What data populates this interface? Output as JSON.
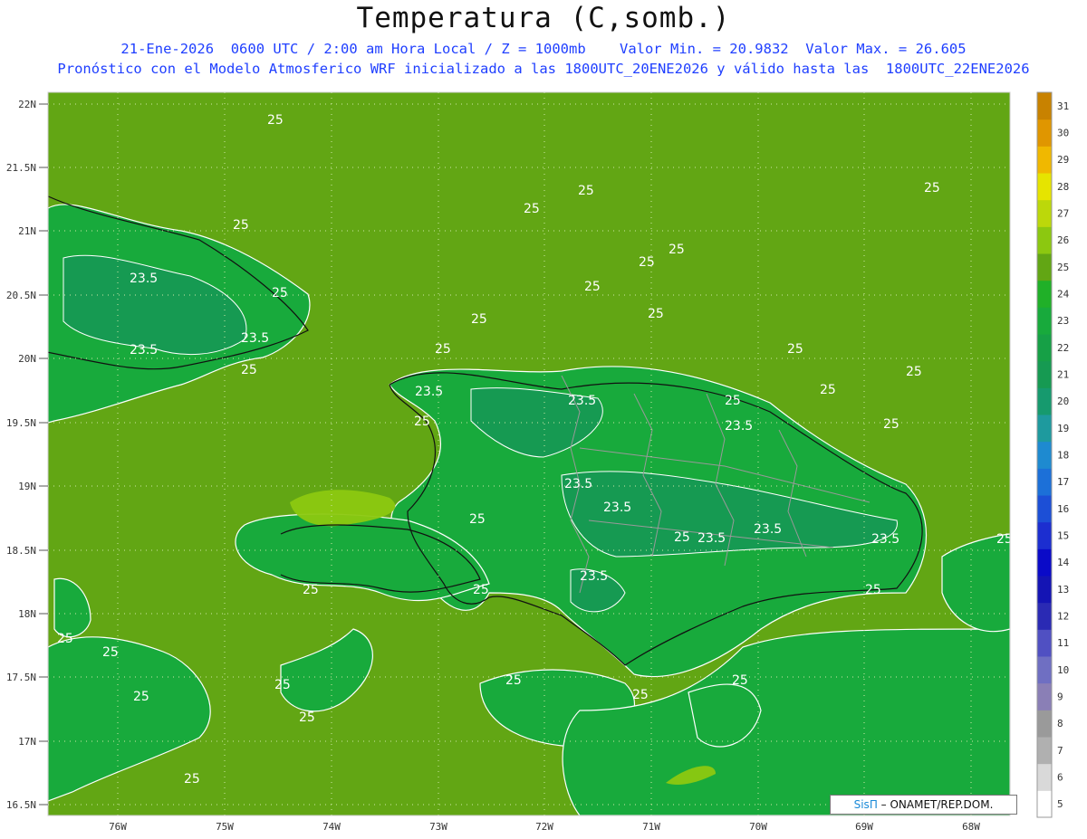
{
  "header": {
    "title": "Temperatura (C,somb.)",
    "line1": "21-Ene-2026  0600 UTC / 2:00 am Hora Local / Z = 1000mb    Valor Min. = 20.9832  Valor Max. = 26.605",
    "line2": "Pronóstico con el Modelo Atmosferico WRF inicializado a las 1800UTC_20ENE2026 y válido hasta las  1800UTC_22ENE2026"
  },
  "axes": {
    "lat_labels": [
      "22N",
      "21.5N",
      "21N",
      "20.5N",
      "20N",
      "19.5N",
      "19N",
      "18.5N",
      "18N",
      "17.5N",
      "17N",
      "16.5N"
    ],
    "lon_labels": [
      "76W",
      "75W",
      "74W",
      "73W",
      "72W",
      "71W",
      "70W",
      "69W",
      "68W"
    ]
  },
  "contour_labels": [
    "25",
    "23.5"
  ],
  "colorbar": {
    "levels": [
      "5",
      "6",
      "7",
      "8",
      "9",
      "10",
      "11",
      "12",
      "13",
      "14",
      "15",
      "16",
      "17",
      "18",
      "19",
      "20",
      "21",
      "22",
      "23",
      "24",
      "25",
      "26",
      "27",
      "28",
      "29",
      "30",
      "31"
    ],
    "colors": [
      "#ffffff",
      "#d9d9d9",
      "#b0b0b0",
      "#9a9a9a",
      "#8a7fb6",
      "#6f6fc2",
      "#5050c2",
      "#2a2ab4",
      "#1414b4",
      "#0a0ac8",
      "#1c2ed0",
      "#1c4fd6",
      "#1c70d8",
      "#1e8ad0",
      "#1e9a9e",
      "#169a6e",
      "#169a52",
      "#16a046",
      "#18aa3c",
      "#20b028",
      "#62a614",
      "#8cc810",
      "#bcd80a",
      "#e6e400",
      "#f0b800",
      "#e09600",
      "#c88200"
    ]
  },
  "credit": {
    "brand": "SisΠ",
    "text": "– ONAMET/REP.DOM."
  },
  "palette": {
    "ocean": "#62a614",
    "land": "#18aa3c",
    "warm": "#8cc810",
    "cool": "#169a52"
  }
}
